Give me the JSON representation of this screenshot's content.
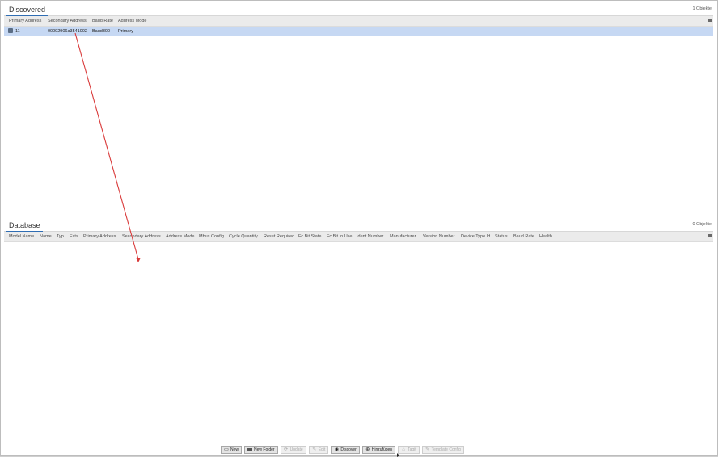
{
  "discovered": {
    "tab": "Discovered",
    "count": "1 Objekte",
    "columns": [
      "Primary Address",
      "Secondary Address",
      "Baud Rate",
      "Address Mode"
    ],
    "rows": [
      {
        "primary": "11",
        "secondary": "00092906a3541002",
        "baud": "Baud300",
        "mode": "Primary"
      }
    ]
  },
  "database": {
    "tab": "Database",
    "count": "0 Objekte",
    "columns": [
      "Model Name",
      "Name",
      "Typ",
      "Exts",
      "Primary Address",
      "Secondary Address",
      "Address Mode",
      "Mbus Config",
      "Cycle Quantity",
      "Reset Required",
      "Fc Bit State",
      "Fc Bit In Use",
      "Ident Number",
      "Manufacturer",
      "Version Number",
      "Device Type Id",
      "Status",
      "Baud Rate",
      "Health"
    ]
  },
  "toolbar": {
    "buttons": [
      {
        "label": "New",
        "icon": "new-icon",
        "disabled": false
      },
      {
        "label": "New Folder",
        "icon": "folder-icon",
        "disabled": false
      },
      {
        "label": "Update",
        "icon": "update-icon",
        "disabled": true
      },
      {
        "label": "Edit",
        "icon": "edit-icon",
        "disabled": true
      },
      {
        "label": "Discover",
        "icon": "binoculars-icon",
        "disabled": false
      },
      {
        "label": "Hinzufügen",
        "icon": "add-icon",
        "disabled": false
      },
      {
        "label": "Tagit",
        "icon": "tag-icon",
        "disabled": true
      },
      {
        "label": "Template Config",
        "icon": "template-icon",
        "disabled": true
      }
    ]
  },
  "annotation": {
    "color": "#d93a3a"
  }
}
